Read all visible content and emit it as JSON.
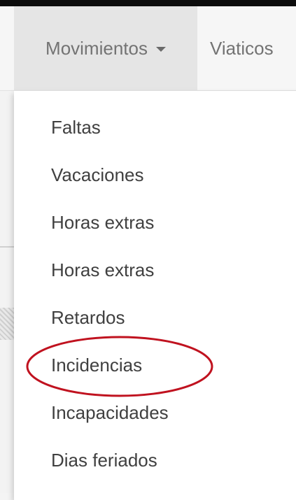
{
  "navbar": {
    "items": [
      {
        "label": "Movimientos",
        "has_dropdown": true,
        "active": true
      },
      {
        "label": "Viaticos"
      }
    ]
  },
  "dropdown": {
    "items": [
      {
        "label": "Faltas"
      },
      {
        "label": "Vacaciones"
      },
      {
        "label": "Horas extras"
      },
      {
        "label": "Horas extras"
      },
      {
        "label": "Retardos"
      },
      {
        "label": "Incidencias",
        "highlighted": true
      },
      {
        "label": "Incapacidades"
      },
      {
        "label": "Dias feriados"
      }
    ]
  },
  "annotation": {
    "type": "circle-highlight",
    "target": "Incidencias",
    "color": "#c0121f"
  },
  "colors": {
    "nav_background": "#f6f6f6",
    "nav_active_background": "#e5e5e5",
    "nav_text": "#737373",
    "menu_text": "#404040",
    "top_border": "#0c0c0c"
  },
  "icons": {
    "dropdown_caret": "caret-down-icon"
  }
}
